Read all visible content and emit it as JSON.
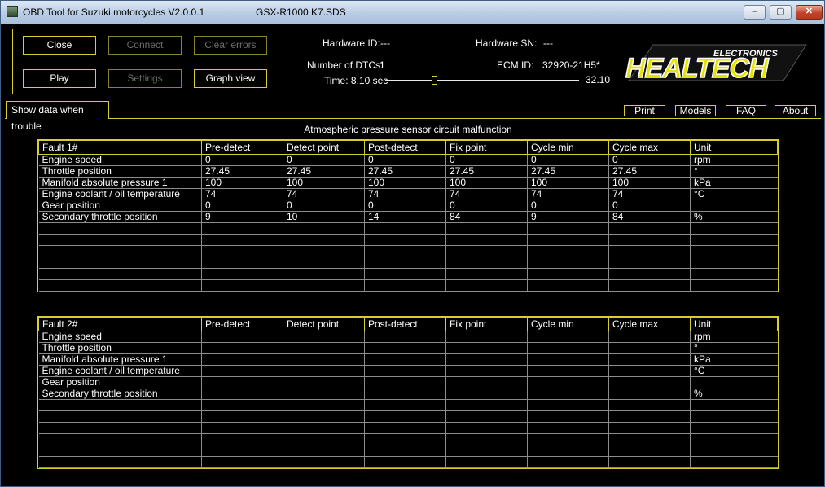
{
  "window": {
    "title": "OBD Tool for Suzuki motorcycles V2.0.0.1",
    "file": "GSX-R1000 K7.SDS",
    "controls": [
      "‒",
      "▢",
      "✕"
    ]
  },
  "buttons": {
    "close": "Close",
    "connect": "Connect",
    "clear_errors": "Clear errors",
    "play": "Play",
    "settings": "Settings",
    "graph_view": "Graph view"
  },
  "info": {
    "hardware_id_label": "Hardware ID:",
    "hardware_id_value": "---",
    "hardware_sn_label": "Hardware SN:",
    "hardware_sn_value": "---",
    "dtc_label": "Number of DTCs:",
    "dtc_value": "1",
    "ecm_label": "ECM ID:",
    "ecm_value": "32920-21H5*",
    "time_label": "Time: 8.10 sec",
    "time_max": "32.10",
    "time_current": 8.1,
    "time_total": 32.1
  },
  "logo": {
    "main": "HEALTECH",
    "sub": "ELECTRONICS"
  },
  "tabs": {
    "active": "Show data when trouble"
  },
  "menu": {
    "print": "Print",
    "models": "Models",
    "faq": "FAQ",
    "about": "About"
  },
  "fault_description": "Atmospheric pressure sensor circuit malfunction",
  "fault1": {
    "headers": [
      "Fault 1#",
      "Pre-detect",
      "Detect point",
      "Post-detect",
      "Fix point",
      "Cycle min",
      "Cycle max",
      "Unit"
    ],
    "rows": [
      [
        "Engine speed",
        "0",
        "0",
        "0",
        "0",
        "0",
        "0",
        "rpm"
      ],
      [
        "Throttle position",
        "27.45",
        "27.45",
        "27.45",
        "27.45",
        "27.45",
        "27.45",
        "°"
      ],
      [
        "Manifold absolute pressure 1",
        "100",
        "100",
        "100",
        "100",
        "100",
        "100",
        "kPa"
      ],
      [
        "Engine coolant / oil temperature",
        "74",
        "74",
        "74",
        "74",
        "74",
        "74",
        "°C"
      ],
      [
        "Gear position",
        "0",
        "0",
        "0",
        "0",
        "0",
        "0",
        ""
      ],
      [
        "Secondary throttle position",
        "9",
        "10",
        "14",
        "84",
        "9",
        "84",
        "%"
      ],
      [
        "",
        "",
        "",
        "",
        "",
        "",
        "",
        ""
      ],
      [
        "",
        "",
        "",
        "",
        "",
        "",
        "",
        ""
      ],
      [
        "",
        "",
        "",
        "",
        "",
        "",
        "",
        ""
      ],
      [
        "",
        "",
        "",
        "",
        "",
        "",
        "",
        ""
      ],
      [
        "",
        "",
        "",
        "",
        "",
        "",
        "",
        ""
      ],
      [
        "",
        "",
        "",
        "",
        "",
        "",
        "",
        ""
      ]
    ]
  },
  "fault2": {
    "headers": [
      "Fault 2#",
      "Pre-detect",
      "Detect point",
      "Post-detect",
      "Fix point",
      "Cycle min",
      "Cycle max",
      "Unit"
    ],
    "rows": [
      [
        "Engine speed",
        "",
        "",
        "",
        "",
        "",
        "",
        "rpm"
      ],
      [
        "Throttle position",
        "",
        "",
        "",
        "",
        "",
        "",
        "°"
      ],
      [
        "Manifold absolute pressure 1",
        "",
        "",
        "",
        "",
        "",
        "",
        "kPa"
      ],
      [
        "Engine coolant / oil temperature",
        "",
        "",
        "",
        "",
        "",
        "",
        "°C"
      ],
      [
        "Gear position",
        "",
        "",
        "",
        "",
        "",
        "",
        ""
      ],
      [
        "Secondary throttle position",
        "",
        "",
        "",
        "",
        "",
        "",
        "%"
      ],
      [
        "",
        "",
        "",
        "",
        "",
        "",
        "",
        ""
      ],
      [
        "",
        "",
        "",
        "",
        "",
        "",
        "",
        ""
      ],
      [
        "",
        "",
        "",
        "",
        "",
        "",
        "",
        ""
      ],
      [
        "",
        "",
        "",
        "",
        "",
        "",
        "",
        ""
      ],
      [
        "",
        "",
        "",
        "",
        "",
        "",
        "",
        ""
      ],
      [
        "",
        "",
        "",
        "",
        "",
        "",
        "",
        ""
      ]
    ]
  }
}
